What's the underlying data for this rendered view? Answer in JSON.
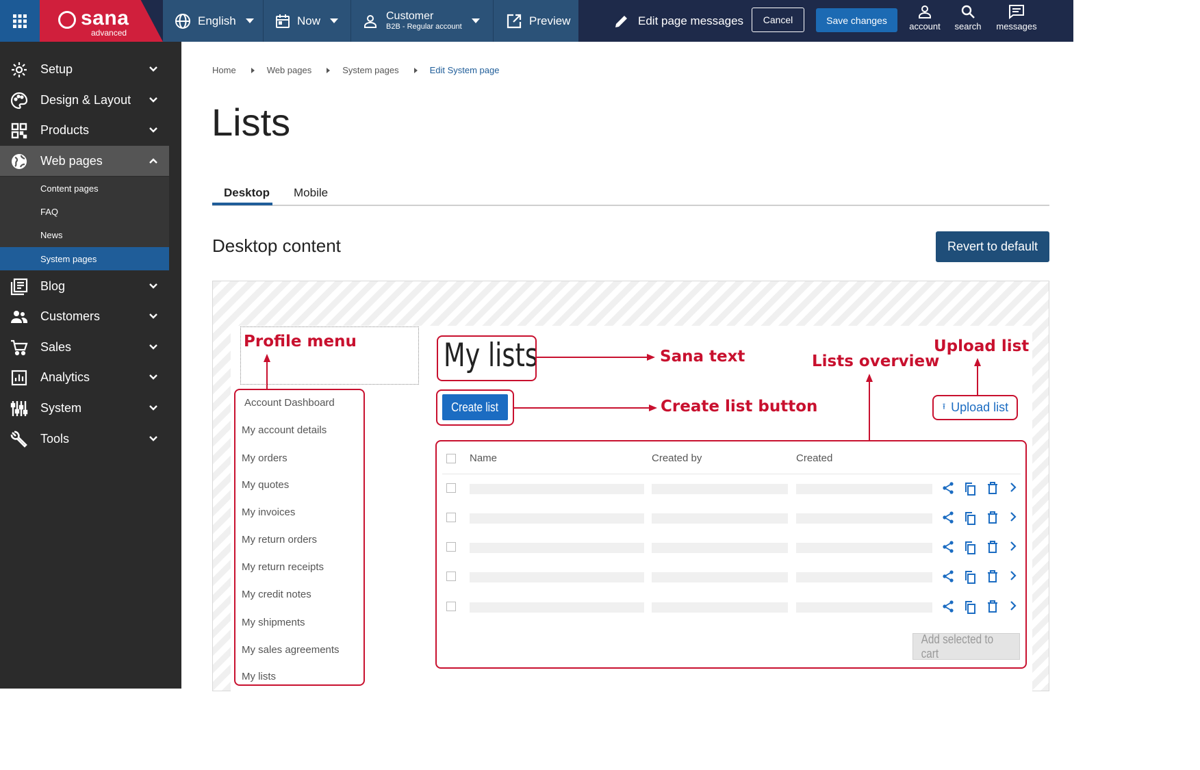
{
  "topbar": {
    "logo_name": "sana",
    "logo_sub": "advanced",
    "language": "English",
    "time": "Now",
    "customer_name": "Customer",
    "customer_sub": "B2B - Regular account",
    "preview": "Preview",
    "edit_messages": "Edit page messages",
    "cancel": "Cancel",
    "save": "Save changes",
    "account": "account",
    "search": "search",
    "messages": "messages"
  },
  "sidebar": {
    "items": [
      {
        "label": "Setup",
        "icon": "gear-icon"
      },
      {
        "label": "Design & Layout",
        "icon": "palette-icon"
      },
      {
        "label": "Products",
        "icon": "qr-grid-icon"
      },
      {
        "label": "Web pages",
        "icon": "globe-icon"
      },
      {
        "label": "Blog",
        "icon": "blog-icon"
      },
      {
        "label": "Customers",
        "icon": "people-icon"
      },
      {
        "label": "Sales",
        "icon": "cart-icon"
      },
      {
        "label": "Analytics",
        "icon": "chart-icon"
      },
      {
        "label": "System",
        "icon": "sliders-icon"
      },
      {
        "label": "Tools",
        "icon": "wrench-icon"
      }
    ],
    "subitems": [
      "Content pages",
      "FAQ",
      "News",
      "System pages"
    ]
  },
  "breadcrumb": [
    "Home",
    "Web pages",
    "System pages",
    "Edit System page"
  ],
  "page_title": "Lists",
  "tabs": [
    "Desktop",
    "Mobile"
  ],
  "section_title": "Desktop content",
  "revert": "Revert to default",
  "profile_menu": [
    "Account Dashboard",
    "My account details",
    "My orders",
    "My quotes",
    "My invoices",
    "My return orders",
    "My return receipts",
    "My credit notes",
    "My shipments",
    "My sales agreements",
    "My lists"
  ],
  "content": {
    "heading": "My lists",
    "create_button": "Create list",
    "upload_button": "Upload list",
    "columns": [
      "Name",
      "Created by",
      "Created"
    ],
    "add_to_cart": "Add selected to cart"
  },
  "annotations": {
    "profile_menu": "Profile menu",
    "sana_text": "Sana text",
    "create_list_button": "Create list button",
    "lists_overview": "Lists overview",
    "upload_list": "Upload list"
  },
  "colors": {
    "topbar": "#1e2a4a",
    "brand_red": "#d01f3c",
    "accent_blue": "#1f5d99",
    "annotation_red": "#c8102e"
  }
}
